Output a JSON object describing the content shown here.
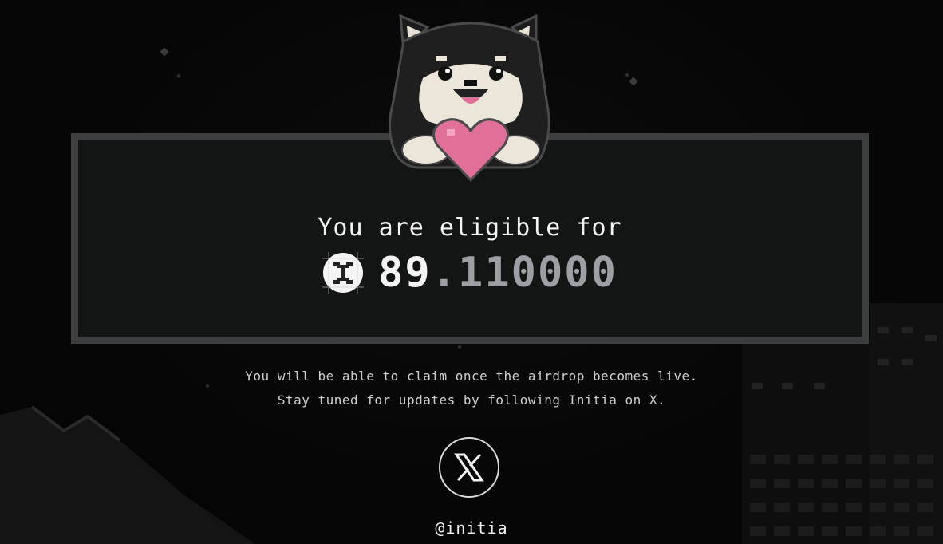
{
  "card": {
    "title": "You are eligible for",
    "amount_integer": "89",
    "amount_decimal": ".110000",
    "token_icon": "initia-token-icon"
  },
  "notice": {
    "line1": "You will be able to claim once the airdrop becomes live.",
    "line2": "Stay tuned for updates by following Initia on X."
  },
  "social": {
    "icon": "x-logo-icon",
    "handle": "@initia"
  },
  "colors": {
    "background": "#050505",
    "card_border": "#3c3e40",
    "card_fill": "#131515",
    "amount_decimal": "#9c9fa3",
    "heart": "#e0709a"
  }
}
